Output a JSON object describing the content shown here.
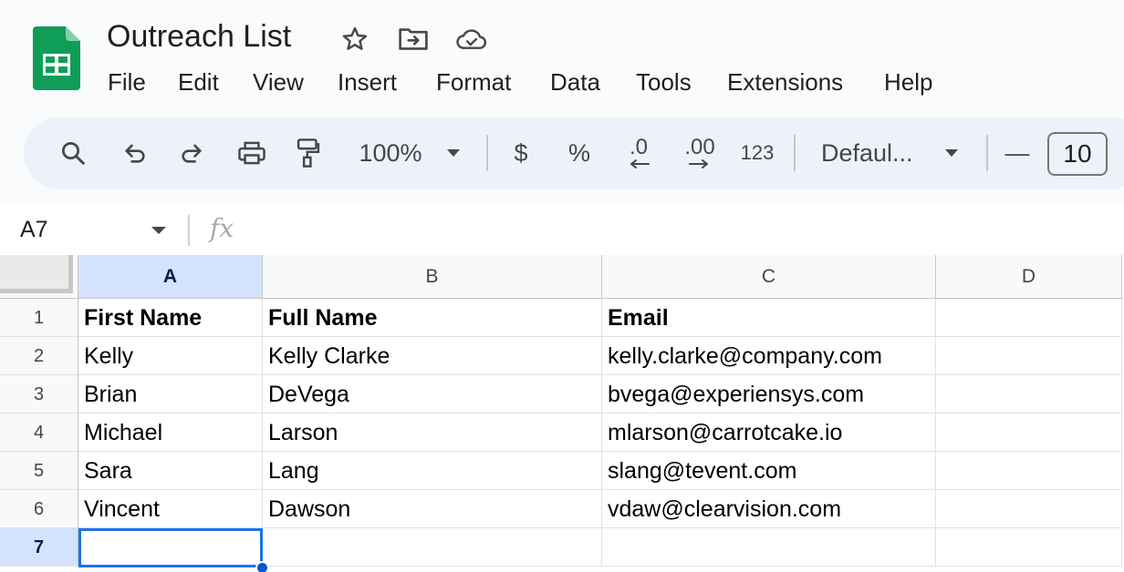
{
  "app": {
    "doc_title": "Outreach List",
    "title_icons": [
      "star-icon",
      "move-to-folder-icon",
      "cloud-saved-icon"
    ],
    "menu": [
      "File",
      "Edit",
      "View",
      "Insert",
      "Format",
      "Data",
      "Tools",
      "Extensions",
      "Help"
    ]
  },
  "toolbar": {
    "zoom": "100%",
    "currency": "$",
    "percent": "%",
    "decrease_decimal": ".0",
    "increase_decimal": ".00",
    "number_format": "123",
    "font": "Defaul...",
    "font_size_decrease": "—",
    "font_size": "10"
  },
  "formula_bar": {
    "name_box": "A7",
    "fx": "fx",
    "content": ""
  },
  "sheet": {
    "columns": [
      "A",
      "B",
      "C",
      "D"
    ],
    "active_column": "A",
    "row_numbers": [
      "1",
      "2",
      "3",
      "4",
      "5",
      "6",
      "7"
    ],
    "active_row": "7",
    "rows": [
      [
        "First Name",
        "Full Name",
        "Email",
        ""
      ],
      [
        "Kelly",
        "Kelly Clarke",
        "kelly.clarke@company.com",
        ""
      ],
      [
        "Brian",
        "DeVega",
        "bvega@experiensys.com",
        ""
      ],
      [
        "Michael",
        "Larson",
        "mlarson@carrotcake.io",
        ""
      ],
      [
        "Sara",
        "Lang",
        "slang@tevent.com",
        ""
      ],
      [
        "Vincent",
        "Dawson",
        "vdaw@clearvision.com",
        ""
      ],
      [
        "",
        "",
        "",
        ""
      ]
    ]
  },
  "colors": {
    "sheets_green": "#0f9d58",
    "toolbar_bg": "#edf2fa",
    "selection_blue": "#1a73e8",
    "header_active": "#d3e3fd"
  }
}
